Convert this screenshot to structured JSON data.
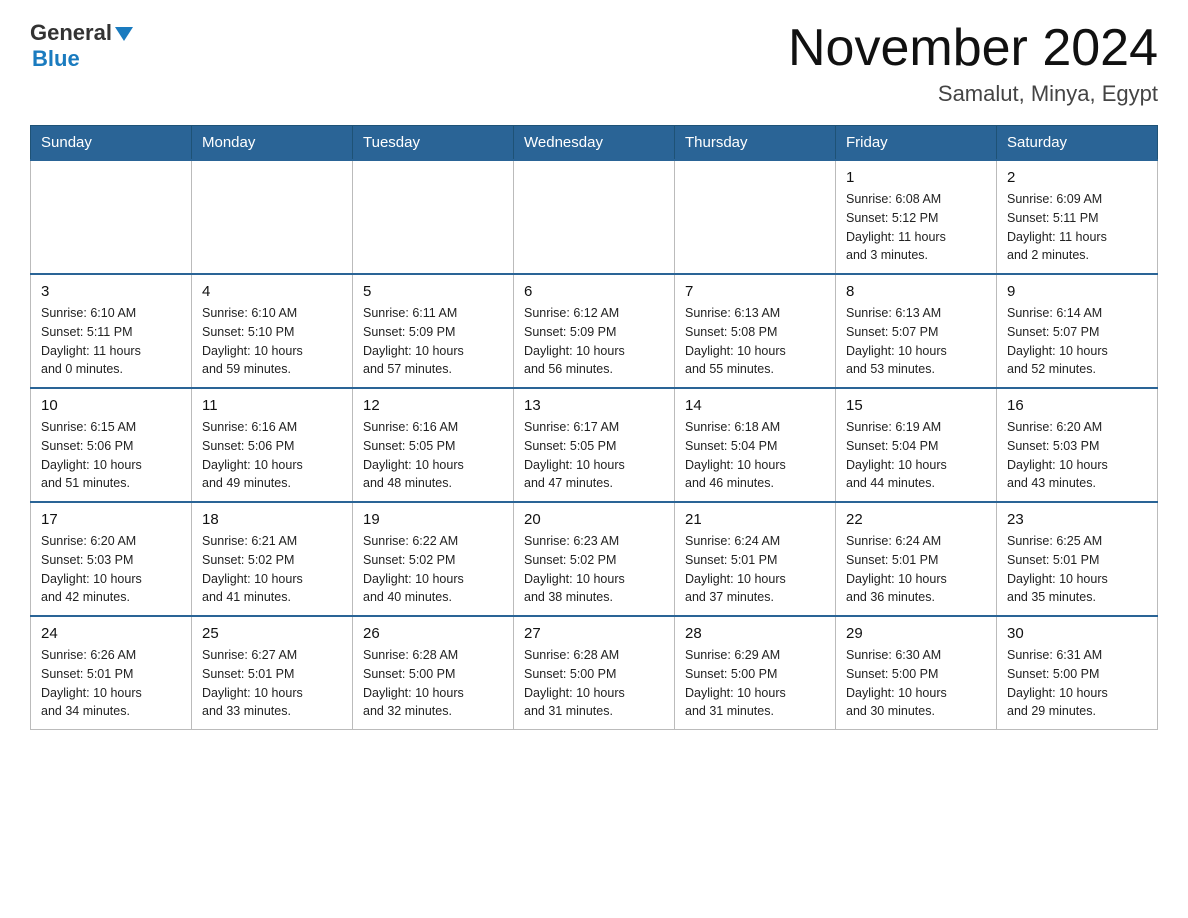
{
  "header": {
    "logo_general": "General",
    "logo_blue": "Blue",
    "month_title": "November 2024",
    "location": "Samalut, Minya, Egypt"
  },
  "days_of_week": [
    "Sunday",
    "Monday",
    "Tuesday",
    "Wednesday",
    "Thursday",
    "Friday",
    "Saturday"
  ],
  "weeks": [
    [
      {
        "day": "",
        "info": ""
      },
      {
        "day": "",
        "info": ""
      },
      {
        "day": "",
        "info": ""
      },
      {
        "day": "",
        "info": ""
      },
      {
        "day": "",
        "info": ""
      },
      {
        "day": "1",
        "info": "Sunrise: 6:08 AM\nSunset: 5:12 PM\nDaylight: 11 hours\nand 3 minutes."
      },
      {
        "day": "2",
        "info": "Sunrise: 6:09 AM\nSunset: 5:11 PM\nDaylight: 11 hours\nand 2 minutes."
      }
    ],
    [
      {
        "day": "3",
        "info": "Sunrise: 6:10 AM\nSunset: 5:11 PM\nDaylight: 11 hours\nand 0 minutes."
      },
      {
        "day": "4",
        "info": "Sunrise: 6:10 AM\nSunset: 5:10 PM\nDaylight: 10 hours\nand 59 minutes."
      },
      {
        "day": "5",
        "info": "Sunrise: 6:11 AM\nSunset: 5:09 PM\nDaylight: 10 hours\nand 57 minutes."
      },
      {
        "day": "6",
        "info": "Sunrise: 6:12 AM\nSunset: 5:09 PM\nDaylight: 10 hours\nand 56 minutes."
      },
      {
        "day": "7",
        "info": "Sunrise: 6:13 AM\nSunset: 5:08 PM\nDaylight: 10 hours\nand 55 minutes."
      },
      {
        "day": "8",
        "info": "Sunrise: 6:13 AM\nSunset: 5:07 PM\nDaylight: 10 hours\nand 53 minutes."
      },
      {
        "day": "9",
        "info": "Sunrise: 6:14 AM\nSunset: 5:07 PM\nDaylight: 10 hours\nand 52 minutes."
      }
    ],
    [
      {
        "day": "10",
        "info": "Sunrise: 6:15 AM\nSunset: 5:06 PM\nDaylight: 10 hours\nand 51 minutes."
      },
      {
        "day": "11",
        "info": "Sunrise: 6:16 AM\nSunset: 5:06 PM\nDaylight: 10 hours\nand 49 minutes."
      },
      {
        "day": "12",
        "info": "Sunrise: 6:16 AM\nSunset: 5:05 PM\nDaylight: 10 hours\nand 48 minutes."
      },
      {
        "day": "13",
        "info": "Sunrise: 6:17 AM\nSunset: 5:05 PM\nDaylight: 10 hours\nand 47 minutes."
      },
      {
        "day": "14",
        "info": "Sunrise: 6:18 AM\nSunset: 5:04 PM\nDaylight: 10 hours\nand 46 minutes."
      },
      {
        "day": "15",
        "info": "Sunrise: 6:19 AM\nSunset: 5:04 PM\nDaylight: 10 hours\nand 44 minutes."
      },
      {
        "day": "16",
        "info": "Sunrise: 6:20 AM\nSunset: 5:03 PM\nDaylight: 10 hours\nand 43 minutes."
      }
    ],
    [
      {
        "day": "17",
        "info": "Sunrise: 6:20 AM\nSunset: 5:03 PM\nDaylight: 10 hours\nand 42 minutes."
      },
      {
        "day": "18",
        "info": "Sunrise: 6:21 AM\nSunset: 5:02 PM\nDaylight: 10 hours\nand 41 minutes."
      },
      {
        "day": "19",
        "info": "Sunrise: 6:22 AM\nSunset: 5:02 PM\nDaylight: 10 hours\nand 40 minutes."
      },
      {
        "day": "20",
        "info": "Sunrise: 6:23 AM\nSunset: 5:02 PM\nDaylight: 10 hours\nand 38 minutes."
      },
      {
        "day": "21",
        "info": "Sunrise: 6:24 AM\nSunset: 5:01 PM\nDaylight: 10 hours\nand 37 minutes."
      },
      {
        "day": "22",
        "info": "Sunrise: 6:24 AM\nSunset: 5:01 PM\nDaylight: 10 hours\nand 36 minutes."
      },
      {
        "day": "23",
        "info": "Sunrise: 6:25 AM\nSunset: 5:01 PM\nDaylight: 10 hours\nand 35 minutes."
      }
    ],
    [
      {
        "day": "24",
        "info": "Sunrise: 6:26 AM\nSunset: 5:01 PM\nDaylight: 10 hours\nand 34 minutes."
      },
      {
        "day": "25",
        "info": "Sunrise: 6:27 AM\nSunset: 5:01 PM\nDaylight: 10 hours\nand 33 minutes."
      },
      {
        "day": "26",
        "info": "Sunrise: 6:28 AM\nSunset: 5:00 PM\nDaylight: 10 hours\nand 32 minutes."
      },
      {
        "day": "27",
        "info": "Sunrise: 6:28 AM\nSunset: 5:00 PM\nDaylight: 10 hours\nand 31 minutes."
      },
      {
        "day": "28",
        "info": "Sunrise: 6:29 AM\nSunset: 5:00 PM\nDaylight: 10 hours\nand 31 minutes."
      },
      {
        "day": "29",
        "info": "Sunrise: 6:30 AM\nSunset: 5:00 PM\nDaylight: 10 hours\nand 30 minutes."
      },
      {
        "day": "30",
        "info": "Sunrise: 6:31 AM\nSunset: 5:00 PM\nDaylight: 10 hours\nand 29 minutes."
      }
    ]
  ]
}
